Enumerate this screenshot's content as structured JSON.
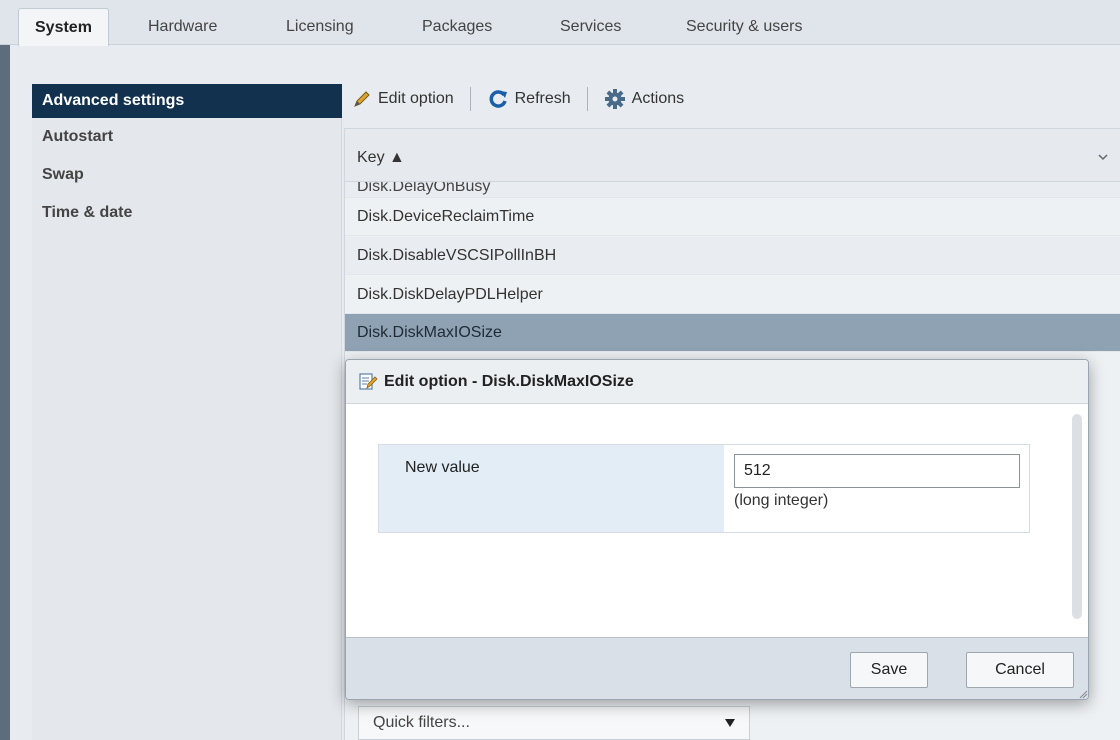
{
  "tabs": [
    {
      "label": "System",
      "active": true
    },
    {
      "label": "Hardware"
    },
    {
      "label": "Licensing"
    },
    {
      "label": "Packages"
    },
    {
      "label": "Services"
    },
    {
      "label": "Security & users"
    }
  ],
  "sidebar": {
    "items": [
      {
        "label": "Advanced settings",
        "active": true
      },
      {
        "label": "Autostart"
      },
      {
        "label": "Swap"
      },
      {
        "label": "Time & date"
      }
    ]
  },
  "toolbar": {
    "edit_label": "Edit option",
    "refresh_label": "Refresh",
    "actions_label": "Actions",
    "accent_color": "#1a5fa8"
  },
  "grid": {
    "column_header": "Key ▲",
    "rows": [
      {
        "key": "Disk.DelayOnBusy"
      },
      {
        "key": "Disk.DeviceReclaimTime"
      },
      {
        "key": "Disk.DisableVSCSIPollInBH"
      },
      {
        "key": "Disk.DiskDelayPDLHelper"
      },
      {
        "key": "Disk.DiskMaxIOSize",
        "selected": true
      }
    ],
    "quick_filters": "Quick filters..."
  },
  "dialog": {
    "title": "Edit option - Disk.DiskMaxIOSize",
    "field_label": "New value",
    "field_value": "512",
    "field_hint": "(long integer)",
    "save_label": "Save",
    "cancel_label": "Cancel"
  },
  "colors": {
    "sidebar_active": "#12314f",
    "selected_row": "#8fa2b3",
    "label_cell": "#e3edf6"
  }
}
